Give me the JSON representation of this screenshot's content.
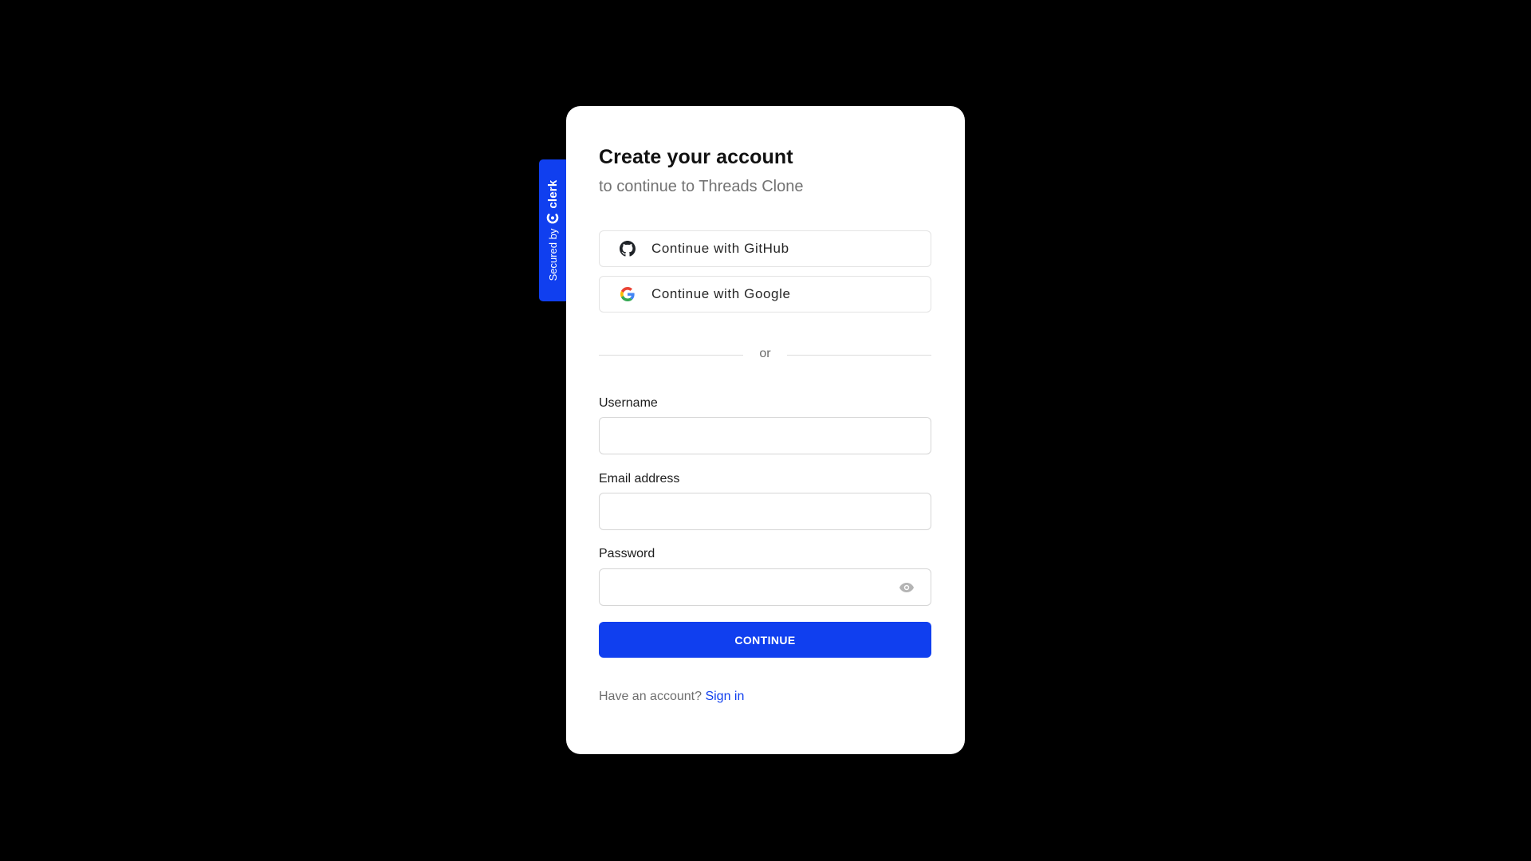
{
  "badge": {
    "secured_text": "Secured by",
    "brand": "clerk"
  },
  "card": {
    "title": "Create your account",
    "subtitle": "to continue to Threads Clone"
  },
  "social": {
    "github_label": "Continue with GitHub",
    "github_icon": "github-icon",
    "google_label": "Continue with Google",
    "google_icon": "google-icon"
  },
  "divider": {
    "text": "or"
  },
  "form": {
    "username_label": "Username",
    "username_value": "",
    "email_label": "Email address",
    "email_value": "",
    "password_label": "Password",
    "password_value": "",
    "password_toggle_icon": "eye-icon",
    "submit_label": "CONTINUE"
  },
  "footer": {
    "prompt": "Have an account?",
    "link": "Sign in"
  },
  "colors": {
    "background": "#000000",
    "card": "#ffffff",
    "accent": "#103fef",
    "muted_text": "#737373"
  }
}
